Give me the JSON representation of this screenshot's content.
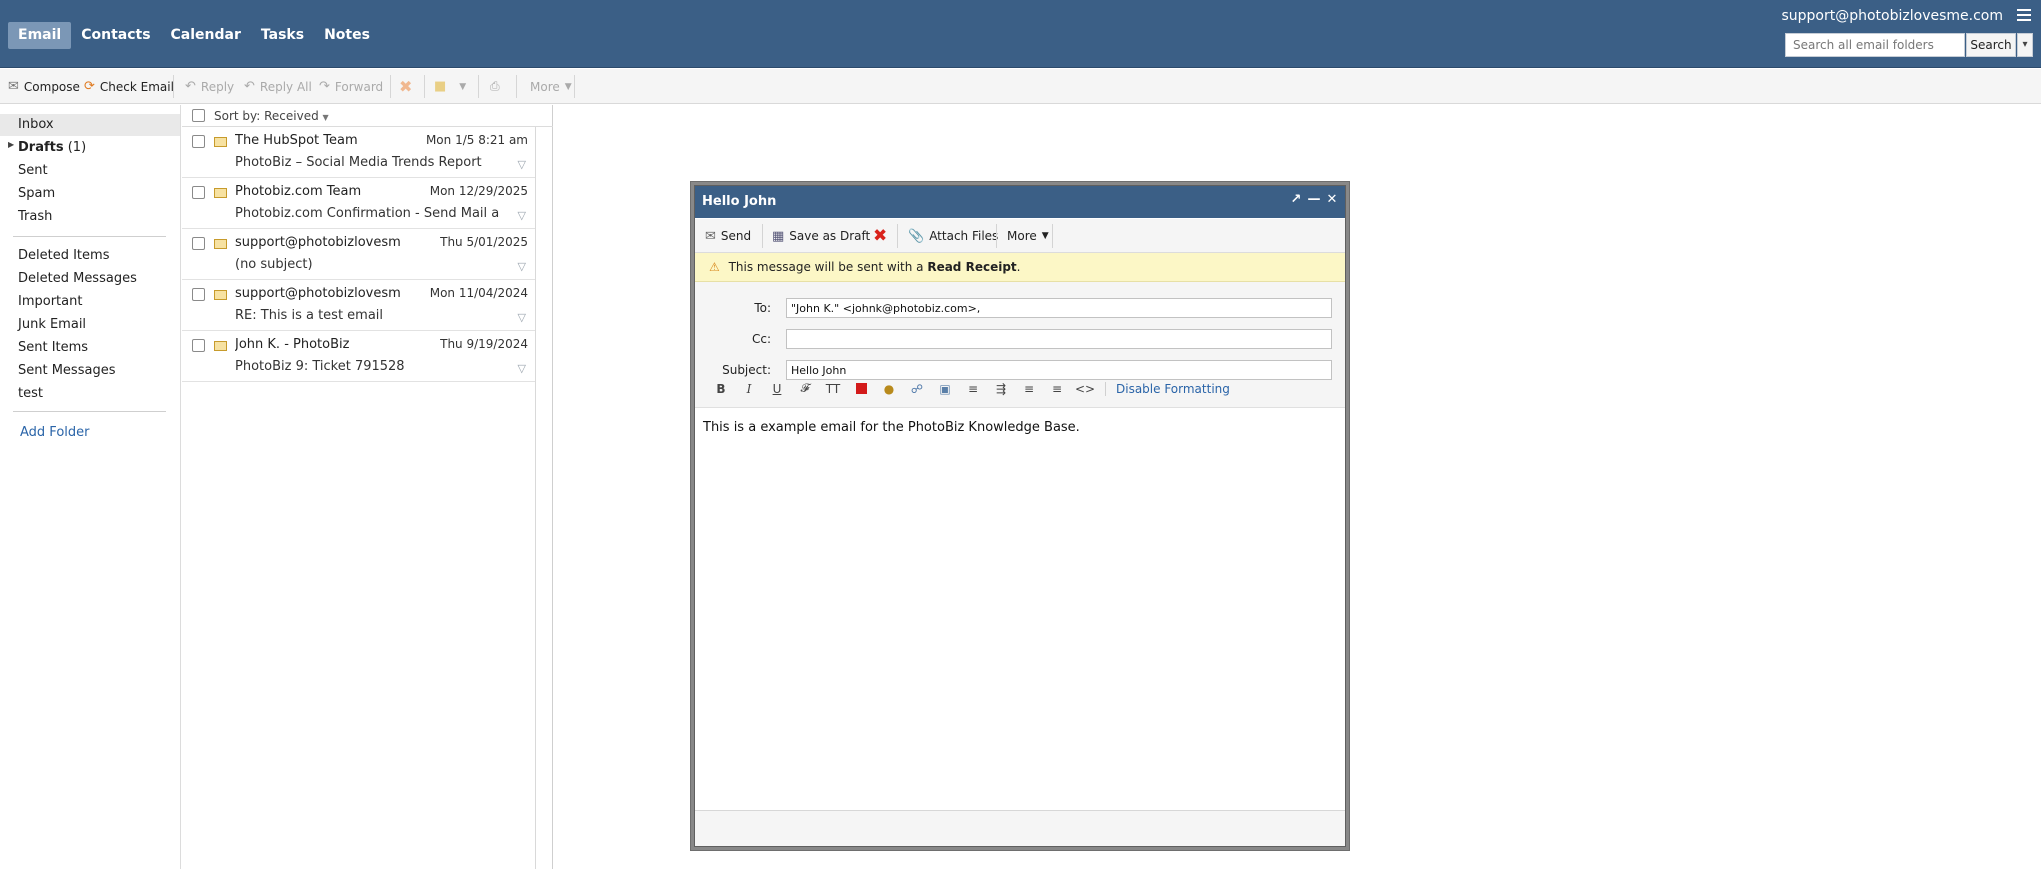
{
  "topnav": {
    "items": [
      "Email",
      "Contacts",
      "Calendar",
      "Tasks",
      "Notes"
    ],
    "active": "Email"
  },
  "account": "support@photobizlovesme.com",
  "search": {
    "placeholder": "Search all email folders",
    "button": "Search"
  },
  "toolbar": {
    "compose": "Compose",
    "check_email": "Check Email",
    "reply": "Reply",
    "reply_all": "Reply All",
    "forward": "Forward",
    "more": "More"
  },
  "folders": {
    "primary": [
      {
        "label": "Inbox",
        "selected": true
      },
      {
        "label": "Drafts",
        "count": "(1)",
        "bold": true
      },
      {
        "label": "Sent"
      },
      {
        "label": "Spam"
      },
      {
        "label": "Trash"
      }
    ],
    "custom": [
      "Deleted Items",
      "Deleted Messages",
      "Important",
      "Junk Email",
      "Sent Items",
      "Sent Messages",
      "test"
    ],
    "add_folder": "Add Folder"
  },
  "message_list": {
    "sort_label": "Sort by: Received",
    "messages": [
      {
        "from": "The HubSpot Team",
        "date": "Mon 1/5 8:21 am",
        "subject": "PhotoBiz – Social Media Trends Report"
      },
      {
        "from": "Photobiz.com Team",
        "date": "Mon 12/29/2025",
        "subject": "Photobiz.com Confirmation - Send Mail as supp..."
      },
      {
        "from": "support@photobizlovesme....",
        "date": "Thu 5/01/2025",
        "subject": "(no subject)"
      },
      {
        "from": "support@photobizlovesme....",
        "date": "Mon 11/04/2024",
        "subject": "RE: This is a test email"
      },
      {
        "from": "John K. - PhotoBiz",
        "date": "Thu 9/19/2024",
        "subject": "PhotoBiz 9: Ticket 791528"
      }
    ]
  },
  "compose": {
    "title": "Hello John",
    "send": "Send",
    "save_draft": "Save as Draft",
    "attach": "Attach Files",
    "more": "More",
    "notice_prefix": "This message will be sent with a ",
    "notice_bold": "Read Receipt",
    "notice_suffix": ".",
    "to_label": "To:",
    "to_value": "\"John K.\" <johnk@photobiz.com>,",
    "cc_label": "Cc:",
    "cc_value": "",
    "subject_label": "Subject:",
    "subject_value": "Hello John",
    "disable_formatting": "Disable Formatting",
    "body": "This is a example email for the PhotoBiz Knowledge Base."
  },
  "colors": {
    "header_blue": "#3b5f86",
    "link_blue": "#2a64a8",
    "notice_yellow": "#fcf7c6"
  }
}
